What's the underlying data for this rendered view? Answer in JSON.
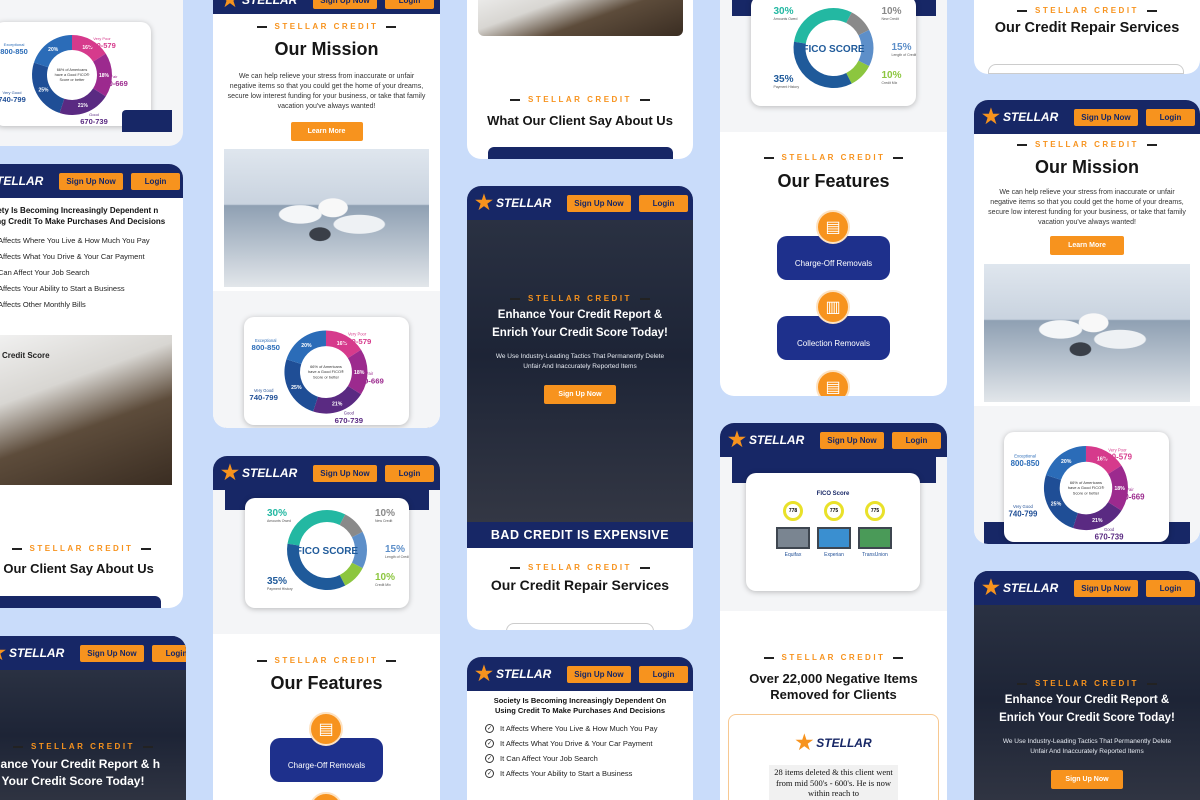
{
  "brand": {
    "name": "STELLAR",
    "sub": "CREDIT"
  },
  "buttons": {
    "signup": "Sign Up Now",
    "login": "Login",
    "learn_more": "Learn More"
  },
  "eyebrow": "STELLAR CREDIT",
  "mission": {
    "title": "Our Mission",
    "body": "We can help relieve your stress from inaccurate or unfair negative items so that you could get the home of your dreams, secure low interest funding for your business, or take that family vacation you've always wanted!"
  },
  "testimonials_title": "What Our Client Say About Us",
  "testimonials_title_cut": "at Our Client Say About Us",
  "services_title": "Our Credit Repair Services",
  "features_title": "Our Features",
  "features": [
    "Charge-Off Removals",
    "Collection Removals"
  ],
  "hero": {
    "title": "Enhance Your Credit Report & Enrich Your Credit Score Today!",
    "title_cut": "nhance Your Credit Report & h Your Credit Score Today!",
    "body": "We Use Industry-Leading Tactics That Permanently Delete Unfair And Inaccurately Reported Items"
  },
  "banner": "BAD CREDIT IS EXPENSIVE",
  "dependence": {
    "title": "Society Is Becoming Increasingly Dependent On Using Credit To Make Purchases And Decisions",
    "title_cut": "ciety Is Becoming Increasingly Dependent n Using Credit To Make Purchases And Decisions",
    "items": [
      "It Affects Where You Live & How Much You Pay",
      "It Affects What You Drive & Your Car Payment",
      "It Can Affect Your Job Search",
      "It Affects Your Ability to Start a Business"
    ],
    "items_cut": [
      "Affects Where You Live & How Much You Pay",
      "Affects What You Drive & Your Car Payment",
      "Can Affect Your Job Search",
      "Affects Your Ability to Start a Business",
      "Affects Other Monthly Bills"
    ]
  },
  "removed": {
    "title": "Over 22,000 Negative Items Removed for Clients",
    "quote": "28 items deleted & this client went from mid 500's - 600's. He is now within reach to"
  },
  "score_chart": {
    "center": "66% of Americans have a Good FICO® Score or better",
    "segments": [
      {
        "range": "300-579",
        "label": "Very Poor",
        "pct": "16%",
        "color": "#d63a8c"
      },
      {
        "range": "580-669",
        "label": "Fair",
        "pct": "18%",
        "color": "#9c2a8e"
      },
      {
        "range": "670-739",
        "label": "Good",
        "pct": "21%",
        "color": "#5a2a82"
      },
      {
        "range": "740-799",
        "label": "Very Good",
        "pct": "25%",
        "color": "#1f4e96"
      },
      {
        "range": "800-850",
        "label": "Exceptional",
        "pct": "20%",
        "color": "#2b6cb8"
      }
    ]
  },
  "fico_chart": {
    "center": "FICO SCORE",
    "segments": [
      {
        "pct": "35",
        "label": "Payment History",
        "color": "#1f5a9a"
      },
      {
        "pct": "30",
        "label": "Amounts Owed",
        "color": "#23b8a2"
      },
      {
        "pct": "15",
        "label": "Length of Credit History",
        "color": "#5d8fc9"
      },
      {
        "pct": "10",
        "label": "New Credit",
        "color": "#8a8a8a"
      },
      {
        "pct": "10",
        "label": "Credit Mix",
        "color": "#8cc63f"
      }
    ]
  },
  "bureaus": {
    "label": "FICO Score",
    "scores": [
      "778",
      "775",
      "775"
    ],
    "names": [
      "Equifax",
      "Experian",
      "TransUnion"
    ]
  },
  "photo_label": "Credit Score"
}
